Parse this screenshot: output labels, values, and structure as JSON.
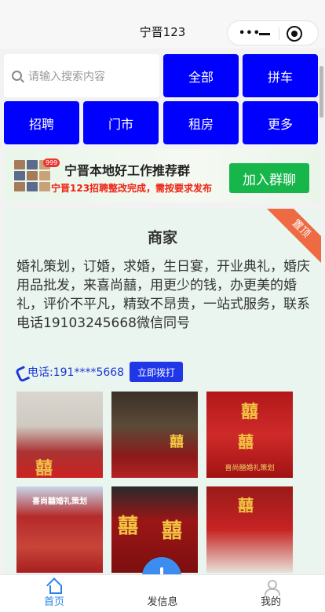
{
  "window": {
    "title": "宁晋123"
  },
  "search": {
    "placeholder": "请输入搜索内容"
  },
  "nav": {
    "items": [
      "全部",
      "拼车",
      "招聘",
      "门市",
      "租房",
      "更多"
    ]
  },
  "banner": {
    "badge": "999",
    "line1": "宁晋本地好工作推荐群",
    "line2": "宁晋123招聘整改完成，需按要求发布",
    "join_label": "加入群聊"
  },
  "card": {
    "ribbon": "置顶",
    "heading": "商家",
    "description": "婚礼策划，订婚，求婚，生日宴，开业典礼，婚庆用品批发，来喜尚囍，用更少的钱，办更美的婚礼，评价不平凡，精致不昂贵，一站式服务，联系电话19103245668微信同号",
    "phone": "电话:191****5668",
    "call_label": "立即拨打",
    "photo_text": {
      "xi": "囍",
      "caption1": "喜尚囍婚礼策划",
      "caption2": "喜尚囍婚礼策划"
    }
  },
  "tabbar": {
    "home": "首页",
    "post": "发信息",
    "mine": "我的"
  },
  "colors": {
    "nav_button": "#0000ff",
    "join_button": "#16b64b",
    "ribbon": "#ed6a43",
    "call_button": "#2037e8",
    "tab_active": "#2a84e8"
  }
}
